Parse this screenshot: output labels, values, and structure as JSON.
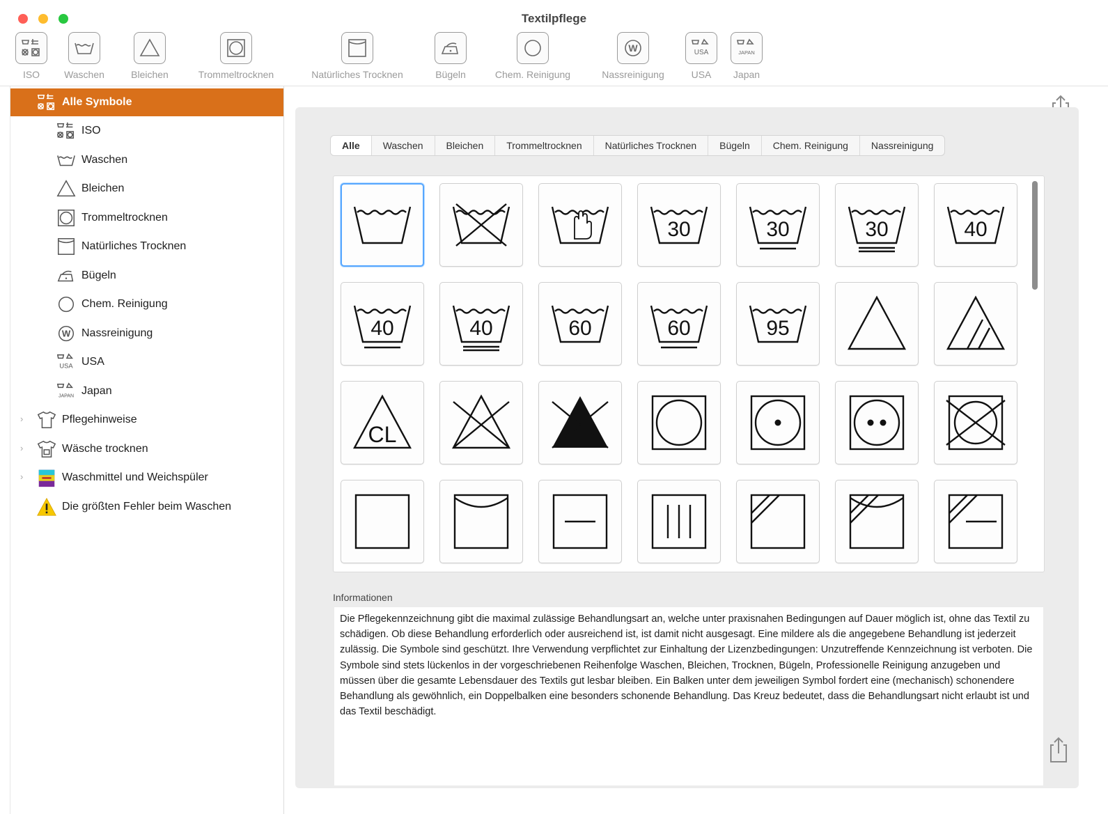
{
  "window": {
    "title": "Textilpflege"
  },
  "toolbar": [
    {
      "label": "ISO",
      "icon": "iso-grid-icon"
    },
    {
      "label": "Waschen",
      "icon": "wash-tub-icon"
    },
    {
      "label": "Bleichen",
      "icon": "bleach-triangle-icon"
    },
    {
      "label": "Trommeltrocknen",
      "icon": "tumble-dry-icon"
    },
    {
      "label": "Natürliches Trocknen",
      "icon": "natural-dry-icon"
    },
    {
      "label": "Bügeln",
      "icon": "iron-icon"
    },
    {
      "label": "Chem. Reinigung",
      "icon": "dry-clean-circle-icon"
    },
    {
      "label": "Nassreinigung",
      "icon": "wet-clean-w-icon"
    },
    {
      "label": "USA",
      "icon": "usa-grid-icon",
      "badge": "USA"
    },
    {
      "label": "Japan",
      "icon": "japan-grid-icon",
      "badge": "JAPAN"
    }
  ],
  "sidebar": {
    "selected": {
      "label": "Alle Symbole",
      "icon": "all-symbols-icon"
    },
    "children": [
      {
        "label": "ISO",
        "icon": "iso-grid-icon"
      },
      {
        "label": "Waschen",
        "icon": "wash-tub-icon"
      },
      {
        "label": "Bleichen",
        "icon": "bleach-triangle-icon"
      },
      {
        "label": "Trommeltrocknen",
        "icon": "tumble-dry-icon"
      },
      {
        "label": "Natürliches Trocknen",
        "icon": "natural-dry-icon"
      },
      {
        "label": "Bügeln",
        "icon": "iron-icon"
      },
      {
        "label": "Chem. Reinigung",
        "icon": "dry-clean-circle-icon"
      },
      {
        "label": "Nassreinigung",
        "icon": "wet-clean-w-icon"
      },
      {
        "label": "USA",
        "icon": "usa-grid-icon"
      },
      {
        "label": "Japan",
        "icon": "japan-grid-icon"
      }
    ],
    "groups": [
      {
        "label": "Pflegehinweise",
        "icon": "tshirt-icon"
      },
      {
        "label": "Wäsche trocknen",
        "icon": "tshirt-dry-icon"
      },
      {
        "label": "Waschmittel und Weichspüler",
        "icon": "detergent-icon"
      },
      {
        "label": "Die größten Fehler beim Waschen",
        "icon": "warning-icon"
      }
    ]
  },
  "tabs": [
    "Alle",
    "Waschen",
    "Bleichen",
    "Trommeltrocknen",
    "Natürliches Trocknen",
    "Bügeln",
    "Chem. Reinigung",
    "Nassreinigung"
  ],
  "active_tab": "Alle",
  "symbols": [
    {
      "name": "wash-symbol",
      "temp": ""
    },
    {
      "name": "do-not-wash-symbol",
      "temp": ""
    },
    {
      "name": "hand-wash-symbol",
      "temp": ""
    },
    {
      "name": "wash-30-symbol",
      "temp": "30"
    },
    {
      "name": "wash-30-gentle-symbol",
      "temp": "30"
    },
    {
      "name": "wash-30-very-gentle-symbol",
      "temp": "30"
    },
    {
      "name": "wash-40-symbol",
      "temp": "40"
    },
    {
      "name": "wash-40-gentle-symbol",
      "temp": "40"
    },
    {
      "name": "wash-40-very-gentle-symbol",
      "temp": "40"
    },
    {
      "name": "wash-60-symbol",
      "temp": "60"
    },
    {
      "name": "wash-60-gentle-symbol",
      "temp": "60"
    },
    {
      "name": "wash-95-symbol",
      "temp": "95"
    },
    {
      "name": "bleach-any-symbol",
      "temp": ""
    },
    {
      "name": "bleach-oxygen-symbol",
      "temp": ""
    },
    {
      "name": "bleach-chlorine-symbol",
      "temp": "CL"
    },
    {
      "name": "do-not-bleach-symbol",
      "temp": ""
    },
    {
      "name": "do-not-bleach-filled-symbol",
      "temp": ""
    },
    {
      "name": "tumble-dry-symbol",
      "temp": ""
    },
    {
      "name": "tumble-dry-low-symbol",
      "temp": ""
    },
    {
      "name": "tumble-dry-normal-symbol",
      "temp": ""
    },
    {
      "name": "do-not-tumble-dry-symbol",
      "temp": ""
    },
    {
      "name": "natural-dry-symbol",
      "temp": ""
    },
    {
      "name": "line-dry-symbol",
      "temp": ""
    },
    {
      "name": "dry-flat-symbol",
      "temp": ""
    },
    {
      "name": "drip-dry-symbol",
      "temp": ""
    },
    {
      "name": "shade-dry-symbol",
      "temp": ""
    },
    {
      "name": "line-dry-shade-symbol",
      "temp": ""
    },
    {
      "name": "dry-flat-shade-symbol",
      "temp": ""
    }
  ],
  "info": {
    "label": "Informationen",
    "text": "Die Pflegekennzeichnung gibt die maximal zulässige Behandlungsart an, welche unter praxisnahen Bedingungen auf Dauer möglich ist, ohne das Textil zu schädigen. Ob diese Behandlung erforderlich oder ausreichend ist, ist damit nicht ausgesagt. Eine mildere als die angegebene Behandlung ist jederzeit zulässig. Die Symbole sind geschützt. Ihre Verwendung verpflichtet zur Einhaltung der Lizenzbedingungen: Unzutreffende Kennzeichnung ist verboten. Die Symbole sind stets lückenlos in der vorgeschriebenen Reihenfolge Waschen, Bleichen, Trocknen, Bügeln, Professionelle Reinigung anzugeben und müssen über die gesamte Lebensdauer des Textils gut lesbar bleiben. Ein Balken unter dem jeweiligen Symbol fordert eine (mechanisch) schonendere Behandlung als gewöhnlich, ein Doppelbalken eine besonders schonende Behandlung. Das Kreuz bedeutet, dass die Behandlungsart nicht erlaubt ist und das Textil beschädigt."
  },
  "colors": {
    "accent": "#d9701a",
    "selection_ring": "#57a7ff"
  }
}
